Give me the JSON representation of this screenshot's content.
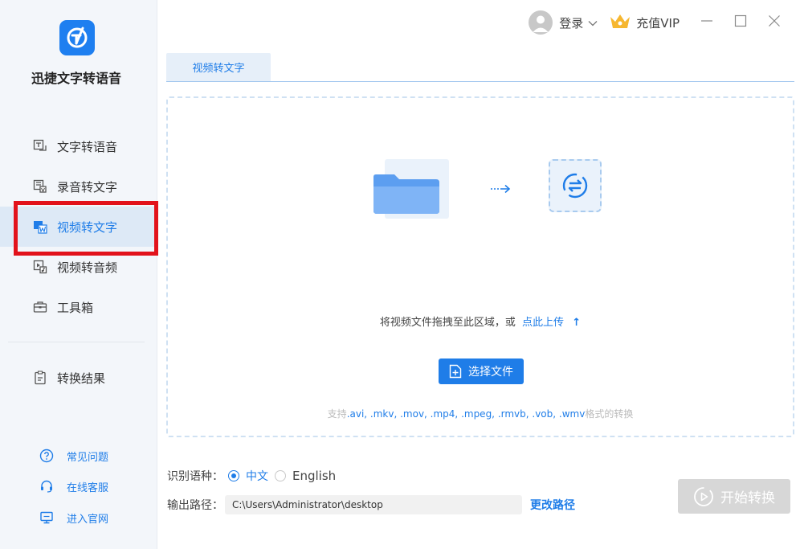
{
  "app": {
    "title": "迅捷文字转语音"
  },
  "sidebar": {
    "items": [
      {
        "label": "文字转语音",
        "icon": "text-to-speech-icon"
      },
      {
        "label": "录音转文字",
        "icon": "recording-to-text-icon"
      },
      {
        "label": "视频转文字",
        "icon": "video-to-text-icon",
        "active": true
      },
      {
        "label": "视频转音频",
        "icon": "video-to-audio-icon"
      },
      {
        "label": "工具箱",
        "icon": "toolbox-icon"
      },
      {
        "label": "转换结果",
        "icon": "results-icon"
      }
    ],
    "footer": [
      {
        "label": "常见问题",
        "icon": "question-icon"
      },
      {
        "label": "在线客服",
        "icon": "headset-icon"
      },
      {
        "label": "进入官网",
        "icon": "website-icon"
      }
    ]
  },
  "topbar": {
    "login_label": "登录",
    "vip_label": "充值VIP"
  },
  "tab": {
    "label": "视频转文字"
  },
  "dropzone": {
    "hint_text": "将视频文件拖拽至此区域，或",
    "upload_link": "点此上传",
    "choose_button": "选择文件",
    "formats_prefix": "支持",
    "formats_exts": ".avi, .mkv, .mov, .mp4, .mpeg, .rmvb, .vob, .wmv",
    "formats_suffix": "格式的转换"
  },
  "settings": {
    "language_label": "识别语种：",
    "language_options": [
      "中文",
      "English"
    ],
    "language_selected": "中文",
    "output_label": "输出路径：",
    "output_path": "C:\\Users\\Administrator\\desktop",
    "change_path_label": "更改路径"
  },
  "start_button": {
    "label": "开始转换",
    "enabled": false
  },
  "colors": {
    "accent": "#1f7de8",
    "highlight": "#e2121b",
    "sidebar_bg": "#f3f6fa",
    "disabled_button": "#d7d7d7"
  }
}
